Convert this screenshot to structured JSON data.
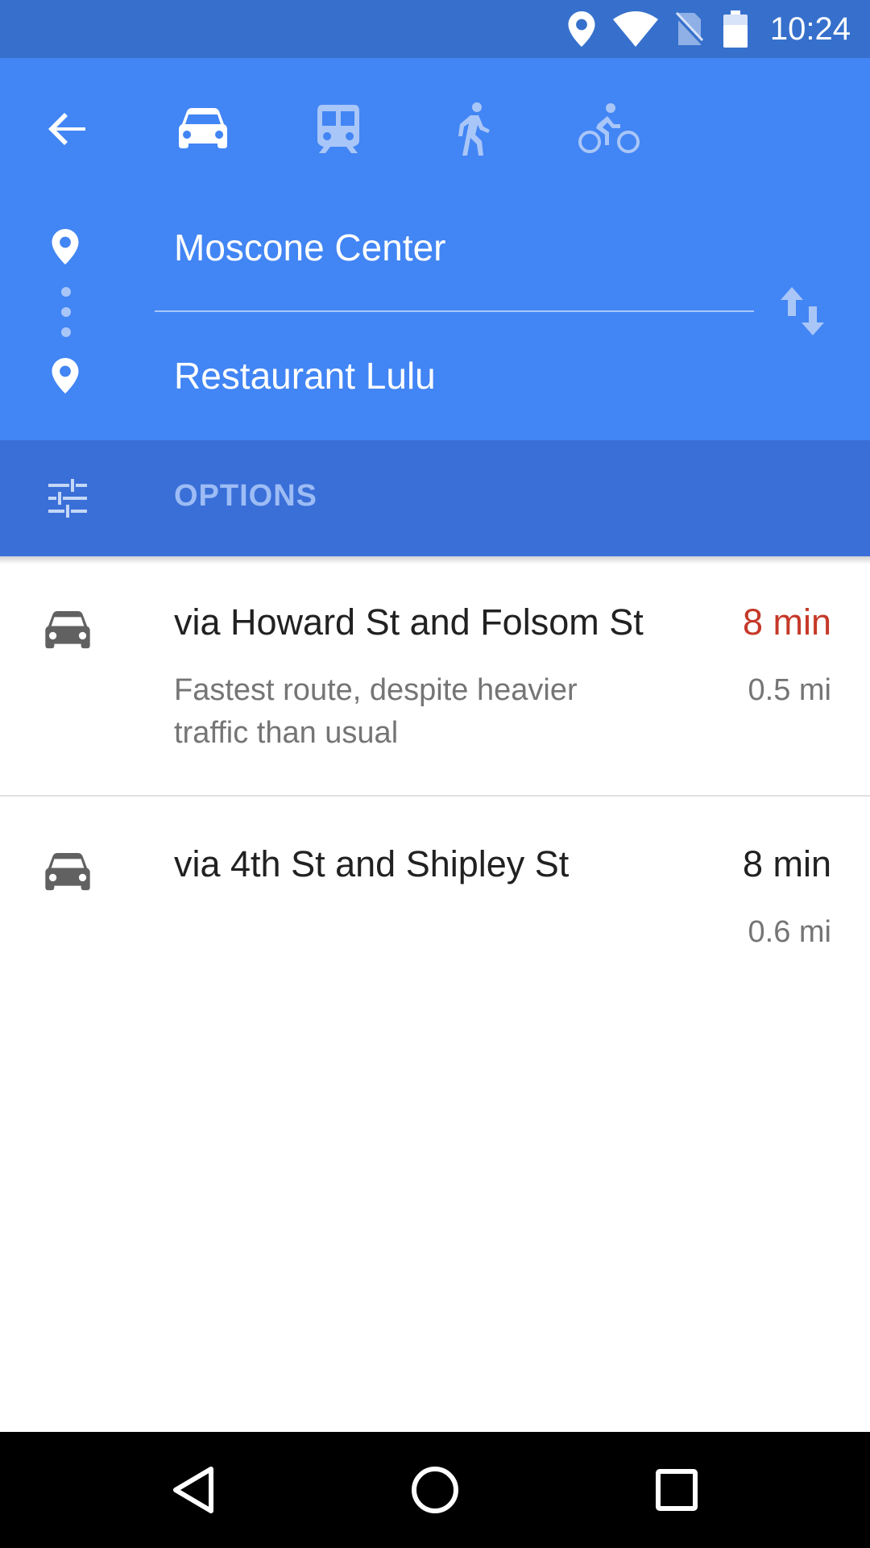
{
  "status_bar": {
    "time": "10:24"
  },
  "header": {
    "travel_modes": [
      {
        "name": "drive",
        "icon": "car-icon",
        "selected": true
      },
      {
        "name": "transit",
        "icon": "train-icon",
        "selected": false
      },
      {
        "name": "walk",
        "icon": "walk-icon",
        "selected": false
      },
      {
        "name": "bike",
        "icon": "bike-icon",
        "selected": false
      }
    ],
    "origin": "Moscone Center",
    "destination": "Restaurant Lulu"
  },
  "options": {
    "label": "OPTIONS"
  },
  "routes": [
    {
      "title": "via Howard St and Folsom St",
      "time": "8 min",
      "distance": "0.5 mi",
      "description": "Fastest route, despite heavier traffic than usual",
      "time_color": "#c53929"
    },
    {
      "title": "via 4th St and Shipley St",
      "time": "8 min",
      "distance": "0.6 mi",
      "description": "",
      "time_color": "#212121"
    }
  ],
  "colors": {
    "header_blue": "#4285f4",
    "options_blue": "#3a6fd8",
    "status_blue": "#3670cc",
    "alert_red": "#c53929"
  }
}
